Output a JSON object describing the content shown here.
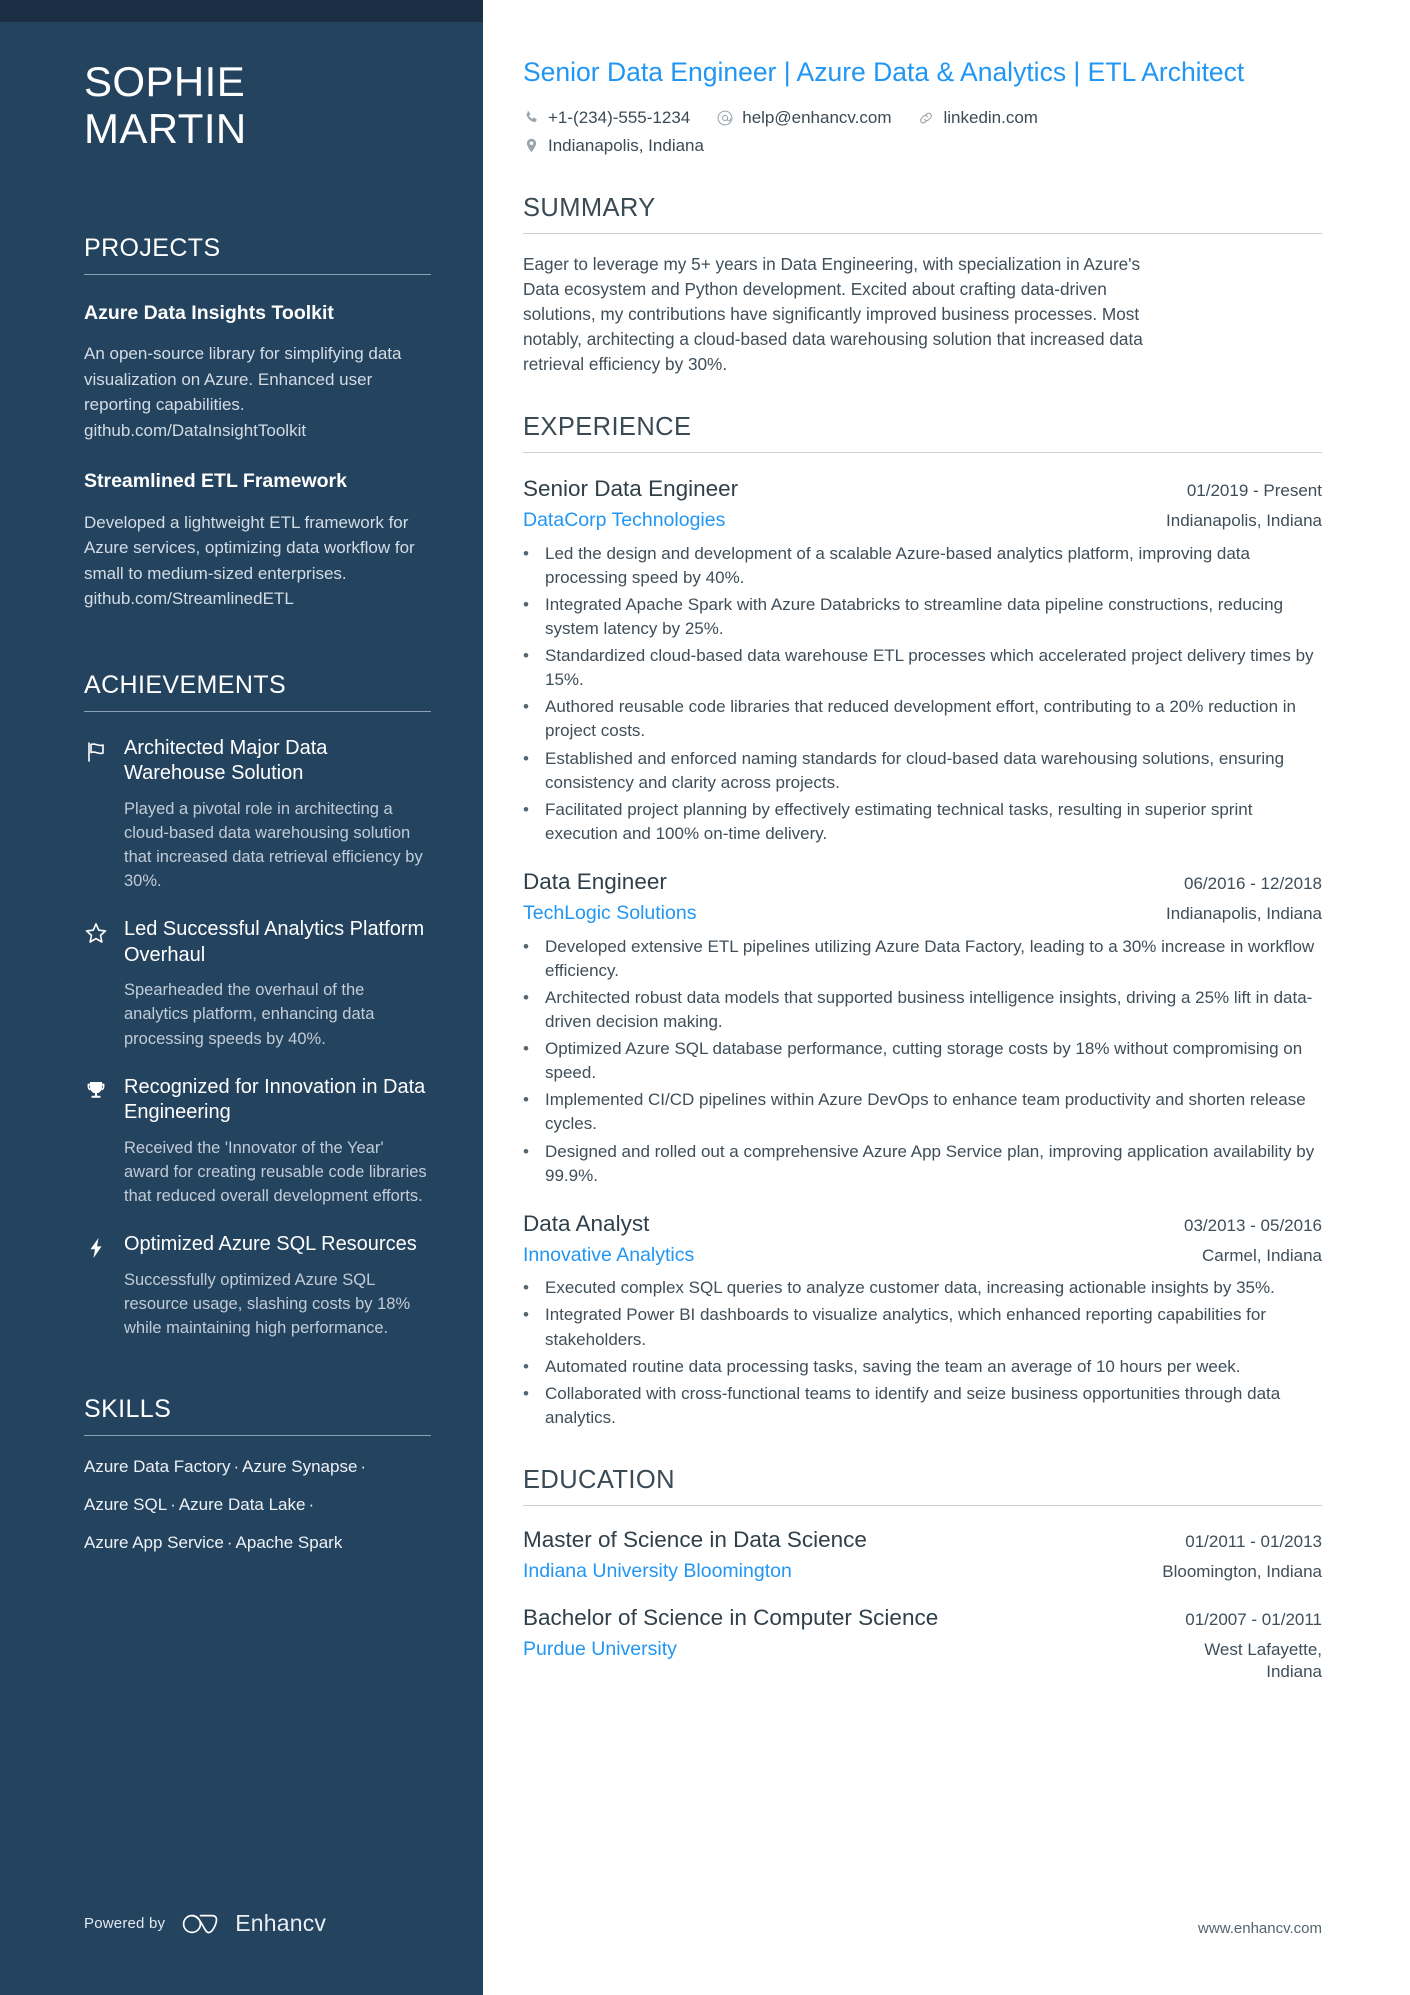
{
  "theme": {
    "sidebar_bg": "#24435f",
    "sidebar_top_strip": "#1a2f44",
    "accent_blue": "#2196f3",
    "body_text": "#3f4e58"
  },
  "sidebar": {
    "name_first": "SOPHIE",
    "name_last": "MARTIN",
    "projects": {
      "title": "PROJECTS",
      "items": [
        {
          "name": "Azure Data Insights Toolkit",
          "description": "An open-source library for simplifying data visualization on Azure. Enhanced user reporting capabilities. github.com/DataInsightToolkit"
        },
        {
          "name": "Streamlined ETL Framework",
          "description": "Developed a lightweight ETL framework for Azure services, optimizing data workflow for small to medium-sized enterprises. github.com/StreamlinedETL"
        }
      ]
    },
    "achievements": {
      "title": "ACHIEVEMENTS",
      "items": [
        {
          "icon": "flag-icon",
          "title": "Architected Major Data Warehouse Solution",
          "description": "Played a pivotal role in architecting a cloud-based data warehousing solution that increased data retrieval efficiency by 30%."
        },
        {
          "icon": "star-icon",
          "title": "Led Successful Analytics Platform Overhaul",
          "description": "Spearheaded the overhaul of the analytics platform, enhancing data processing speeds by 40%."
        },
        {
          "icon": "trophy-icon",
          "title": "Recognized for Innovation in Data Engineering",
          "description": "Received the 'Innovator of the Year' award for creating reusable code libraries that reduced overall development efforts."
        },
        {
          "icon": "lightning-icon",
          "title": "Optimized Azure SQL Resources",
          "description": "Successfully optimized Azure SQL resource usage, slashing costs by 18% while maintaining high performance."
        }
      ]
    },
    "skills": {
      "title": "SKILLS",
      "rows": [
        [
          "Azure Data Factory",
          "Azure Synapse",
          ""
        ],
        [
          "Azure SQL",
          "Azure Data Lake",
          ""
        ],
        [
          "Azure App Service",
          "Apache Spark"
        ]
      ]
    },
    "footer": {
      "powered_by": "Powered by",
      "brand": "Enhancv"
    }
  },
  "main": {
    "headline": "Senior Data Engineer | Azure Data & Analytics | ETL Architect",
    "contacts_row1": [
      {
        "icon": "phone-icon",
        "text": "+1-(234)-555-1234"
      },
      {
        "icon": "email-icon",
        "text": "help@enhancv.com"
      },
      {
        "icon": "link-icon",
        "text": "linkedin.com"
      }
    ],
    "contacts_row2": [
      {
        "icon": "location-pin-icon",
        "text": "Indianapolis, Indiana"
      }
    ],
    "summary": {
      "title": "SUMMARY",
      "text": "Eager to leverage my 5+ years in Data Engineering, with specialization in Azure's Data ecosystem and Python development. Excited about crafting data-driven solutions, my contributions have significantly improved business processes. Most notably, architecting a cloud-based data warehousing solution that increased data retrieval efficiency by 30%."
    },
    "experience": {
      "title": "EXPERIENCE",
      "items": [
        {
          "role": "Senior Data Engineer",
          "date": "01/2019 - Present",
          "org": "DataCorp Technologies",
          "location": "Indianapolis, Indiana",
          "bullets": [
            "Led the design and development of a scalable Azure-based analytics platform, improving data processing speed by 40%.",
            "Integrated Apache Spark with Azure Databricks to streamline data pipeline constructions, reducing system latency by 25%.",
            "Standardized cloud-based data warehouse ETL processes which accelerated project delivery times by 15%.",
            "Authored reusable code libraries that reduced development effort, contributing to a 20% reduction in project costs.",
            "Established and enforced naming standards for cloud-based data warehousing solutions, ensuring consistency and clarity across projects.",
            "Facilitated project planning by effectively estimating technical tasks, resulting in superior sprint execution and 100% on-time delivery."
          ]
        },
        {
          "role": "Data Engineer",
          "date": "06/2016 - 12/2018",
          "org": "TechLogic Solutions",
          "location": "Indianapolis, Indiana",
          "bullets": [
            "Developed extensive ETL pipelines utilizing Azure Data Factory, leading to a 30% increase in workflow efficiency.",
            "Architected robust data models that supported business intelligence insights, driving a 25% lift in data-driven decision making.",
            "Optimized Azure SQL database performance, cutting storage costs by 18% without compromising on speed.",
            "Implemented CI/CD pipelines within Azure DevOps to enhance team productivity and shorten release cycles.",
            "Designed and rolled out a comprehensive Azure App Service plan, improving application availability by 99.9%."
          ]
        },
        {
          "role": "Data Analyst",
          "date": "03/2013 - 05/2016",
          "org": "Innovative Analytics",
          "location": "Carmel, Indiana",
          "bullets": [
            "Executed complex SQL queries to analyze customer data, increasing actionable insights by 35%.",
            "Integrated Power BI dashboards to visualize analytics, which enhanced reporting capabilities for stakeholders.",
            "Automated routine data processing tasks, saving the team an average of 10 hours per week.",
            "Collaborated with cross-functional teams to identify and seize business opportunities through data analytics."
          ]
        }
      ]
    },
    "education": {
      "title": "EDUCATION",
      "items": [
        {
          "degree": "Master of Science in Data Science",
          "date": "01/2011 - 01/2013",
          "org": "Indiana University Bloomington",
          "location": "Bloomington, Indiana"
        },
        {
          "degree": "Bachelor of Science in Computer Science",
          "date": "01/2007 - 01/2011",
          "org": "Purdue University",
          "location": "West Lafayette, Indiana"
        }
      ]
    },
    "footer_url": "www.enhancv.com"
  }
}
